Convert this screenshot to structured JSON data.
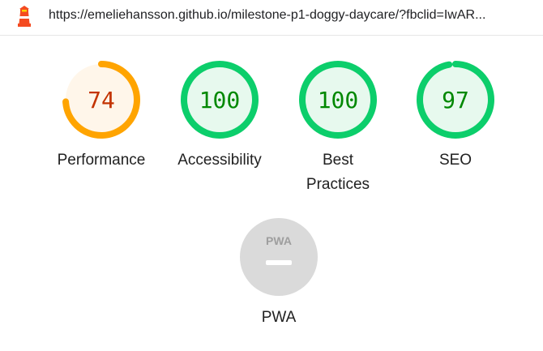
{
  "header": {
    "url": "https://emeliehansson.github.io/milestone-p1-doggy-daycare/?fbclid=IwAR..."
  },
  "gauges": [
    {
      "score": 74,
      "label_line1": "Performance",
      "label_line2": "",
      "status": "average",
      "ring_color": "#ffa400",
      "fill_color": "#fff6ea",
      "text_color": "#c33300"
    },
    {
      "score": 100,
      "label_line1": "Accessibility",
      "label_line2": "",
      "status": "pass",
      "ring_color": "#0cce6b",
      "fill_color": "#e7f9ee",
      "text_color": "#008800"
    },
    {
      "score": 100,
      "label_line1": "Best",
      "label_line2": "Practices",
      "status": "pass",
      "ring_color": "#0cce6b",
      "fill_color": "#e7f9ee",
      "text_color": "#008800"
    },
    {
      "score": 97,
      "label_line1": "SEO",
      "label_line2": "",
      "status": "pass",
      "ring_color": "#0cce6b",
      "fill_color": "#e7f9ee",
      "text_color": "#008800"
    }
  ],
  "pwa": {
    "badge_text": "PWA",
    "label": "PWA",
    "fill_color": "#dadada"
  }
}
